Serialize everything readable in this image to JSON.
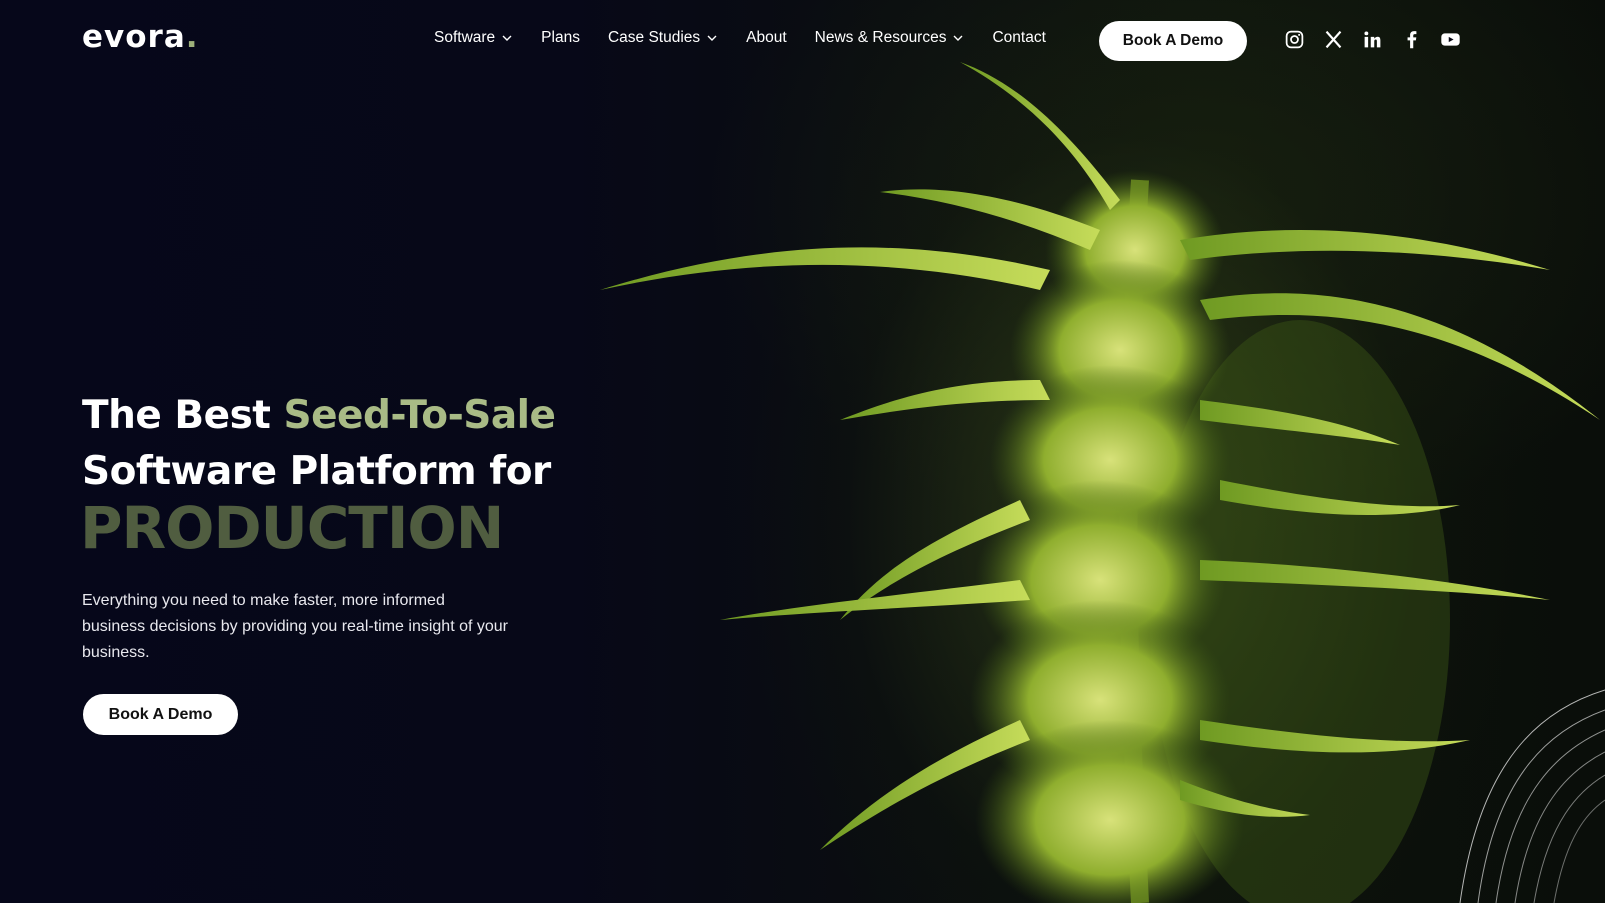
{
  "brand": {
    "name": "evora",
    "dot": "."
  },
  "nav": {
    "items": [
      {
        "label": "Software",
        "has_dropdown": true
      },
      {
        "label": "Plans",
        "has_dropdown": false
      },
      {
        "label": "Case Studies",
        "has_dropdown": true
      },
      {
        "label": "About",
        "has_dropdown": false
      },
      {
        "label": "News & Resources",
        "has_dropdown": true
      },
      {
        "label": "Contact",
        "has_dropdown": false
      }
    ],
    "cta_label": "Book A Demo",
    "socials": [
      "instagram-icon",
      "x-icon",
      "linkedin-icon",
      "facebook-icon",
      "youtube-icon"
    ]
  },
  "hero": {
    "title_part1": "The Best ",
    "title_highlight": "Seed-To-Sale",
    "title_part2": "Software Platform for",
    "rotating_word": "PRODUCTION",
    "description": "Everything you need to make faster, more informed business decisions by providing you real-time insight of your business.",
    "cta_label": "Book A Demo"
  },
  "colors": {
    "background": "#060713",
    "accent": "#a9bb86",
    "rotating_word": "#505d40",
    "button_bg": "#ffffff"
  }
}
